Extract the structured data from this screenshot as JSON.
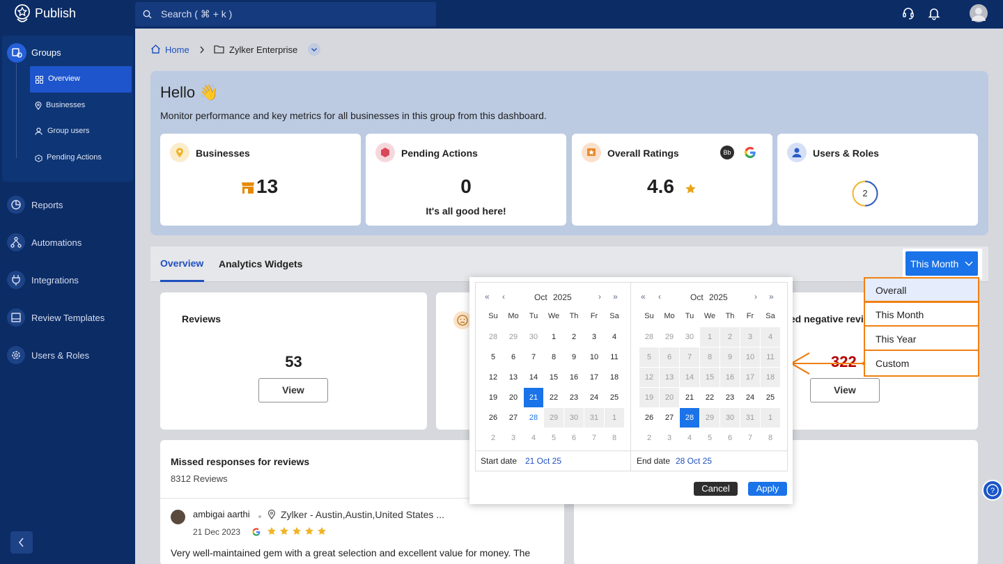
{
  "app": {
    "name": "Publish"
  },
  "topbar": {
    "search_placeholder": "Search ( ⌘ + k )",
    "icons": [
      "headset-icon",
      "bell-icon",
      "avatar"
    ]
  },
  "sidebar": {
    "group_label": "Groups",
    "sub_items": [
      {
        "label": "Overview",
        "icon": "grid-icon",
        "active": true
      },
      {
        "label": "Businesses",
        "icon": "location-pin-icon"
      },
      {
        "label": "Group users",
        "icon": "user-icon"
      },
      {
        "label": "Pending Actions",
        "icon": "hexagon-icon"
      }
    ],
    "items": [
      {
        "label": "Reports",
        "icon": "pie-chart-icon"
      },
      {
        "label": "Automations",
        "icon": "flow-icon"
      },
      {
        "label": "Integrations",
        "icon": "plug-icon"
      },
      {
        "label": "Review Templates",
        "icon": "template-icon"
      },
      {
        "label": "Users & Roles",
        "icon": "gear-icon"
      }
    ],
    "collapse_icon": "chevron-left-icon"
  },
  "breadcrumb": {
    "home": "Home",
    "current": "Zylker Enterprise"
  },
  "hello": {
    "title": "Hello 👋",
    "subtitle": "Monitor performance and key metrics for all businesses in this group from this dashboard."
  },
  "stats": {
    "businesses": {
      "label": "Businesses",
      "value": "13"
    },
    "pending": {
      "label": "Pending Actions",
      "value": "0",
      "note": "It's all good here!"
    },
    "ratings": {
      "label": "Overall Ratings",
      "value": "4.6",
      "badge": "Bb"
    },
    "users": {
      "label": "Users & Roles",
      "value": "2"
    }
  },
  "tabs": {
    "overview": "Overview",
    "analytics": "Analytics Widgets"
  },
  "range": {
    "selected": "This Month",
    "options": [
      "Overall",
      "This Month",
      "This Year",
      "Custom"
    ]
  },
  "widgets": {
    "reviews": {
      "label": "Reviews",
      "value": "53",
      "button": "View"
    },
    "negative": {
      "label": "ied negative revi",
      "value": "322",
      "button": "View"
    }
  },
  "missed": {
    "title": "Missed responses for reviews",
    "count": "8312 Reviews",
    "review": {
      "author": "ambigai aarthi",
      "location": "Zylker - Austin,Austin,United States ...",
      "date": "21 Dec 2023",
      "rating": 5,
      "text": "Very well-maintained gem with a great selection and excellent value for money. The"
    }
  },
  "calendar": {
    "dow": [
      "Su",
      "Mo",
      "Tu",
      "We",
      "Th",
      "Fr",
      "Sa"
    ],
    "left": {
      "month": "Oct",
      "year": "2025",
      "days": [
        "28",
        "29",
        "30",
        "1",
        "2",
        "3",
        "4",
        "5",
        "6",
        "7",
        "8",
        "9",
        "10",
        "11",
        "12",
        "13",
        "14",
        "15",
        "16",
        "17",
        "18",
        "19",
        "20",
        "21",
        "22",
        "23",
        "24",
        "25",
        "26",
        "27",
        "28",
        "29",
        "30",
        "31",
        "1",
        "2",
        "3",
        "4",
        "5",
        "6",
        "7",
        "8"
      ]
    },
    "right": {
      "month": "Oct",
      "year": "2025",
      "days": [
        "28",
        "29",
        "30",
        "1",
        "2",
        "3",
        "4",
        "5",
        "6",
        "7",
        "8",
        "9",
        "10",
        "11",
        "12",
        "13",
        "14",
        "15",
        "16",
        "17",
        "18",
        "19",
        "20",
        "21",
        "22",
        "23",
        "24",
        "25",
        "26",
        "27",
        "28",
        "29",
        "30",
        "31",
        "1",
        "2",
        "3",
        "4",
        "5",
        "6",
        "7",
        "8"
      ]
    },
    "start_label": "Start date",
    "start_value": "21 Oct 25",
    "end_label": "End date",
    "end_value": "28 Oct 25",
    "cancel": "Cancel",
    "apply": "Apply"
  },
  "colors": {
    "nav": "#0c2c66",
    "accent": "#1a73e8",
    "annotation": "#f08012",
    "negative": "#b40000"
  }
}
